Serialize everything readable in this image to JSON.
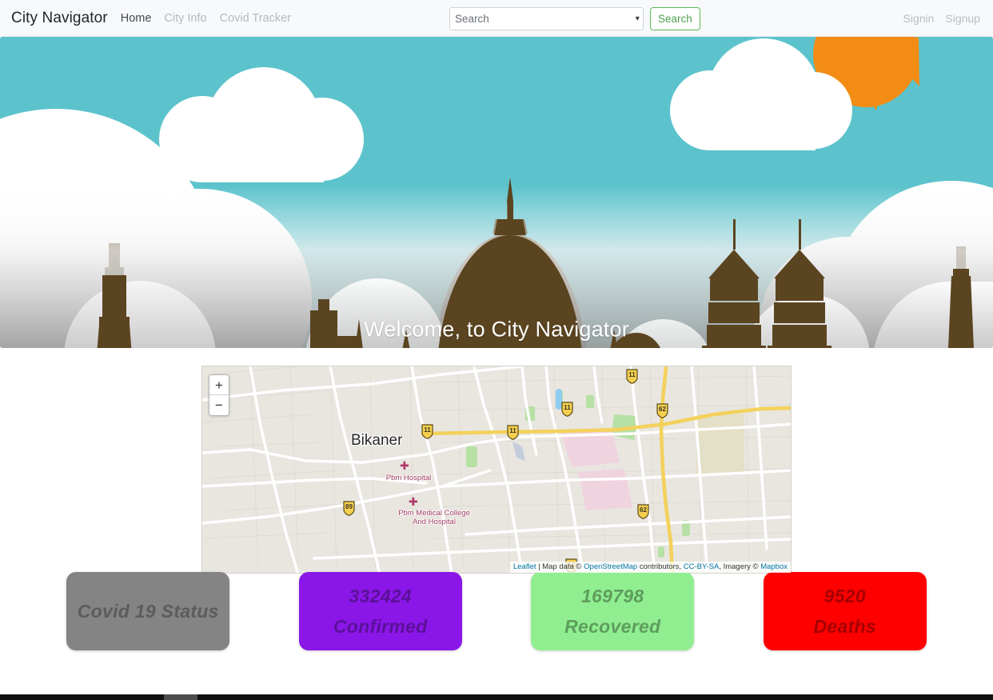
{
  "navbar": {
    "brand": "City Navigator",
    "links": [
      {
        "label": "Home",
        "active": true
      },
      {
        "label": "City Info",
        "active": false
      },
      {
        "label": "Covid Tracker",
        "active": false
      }
    ],
    "search": {
      "placeholder": "Search",
      "selected_value": "Search",
      "button_label": "Search",
      "button_color": "#5cb85c"
    },
    "auth": [
      {
        "label": "Signin"
      },
      {
        "label": "Signup"
      }
    ]
  },
  "hero": {
    "title": "Welcome, to City Navigator",
    "sky_color": "#5cc3cc",
    "sun_color": "#f28c14",
    "building_color": "#5b4420",
    "cloud_color": "#ffffff"
  },
  "map": {
    "city_label": "Bikaner",
    "pois": [
      {
        "name": "Pbm Hospital"
      },
      {
        "name": "Pbm Medical College",
        "name2": "And Hospital"
      }
    ],
    "highway_shields": [
      "11",
      "11",
      "62",
      "11",
      "89",
      "62",
      "62"
    ],
    "zoom_in_label": "+",
    "zoom_out_label": "−",
    "attribution": {
      "leaflet": "Leaflet",
      "sep1": " | Map data © ",
      "osm": "OpenStreetMap",
      "mid": " contributors, ",
      "license": "CC-BY-SA",
      "imagery": ", Imagery © ",
      "mapbox": "Mapbox"
    }
  },
  "covid": {
    "cards": [
      {
        "title": "Covid 19 Status",
        "number": "",
        "label": "",
        "bg": "#848484",
        "fg": "#5c5c5c"
      },
      {
        "title": "",
        "number": "332424",
        "label": "Confirmed",
        "bg": "#8a16e8",
        "fg": "#5b1099"
      },
      {
        "title": "",
        "number": "169798",
        "label": "Recovered",
        "bg": "#90ee90",
        "fg": "#5e9d5e"
      },
      {
        "title": "",
        "number": "9520",
        "label": "Deaths",
        "bg": "#fe0000",
        "fg": "#a60000"
      }
    ]
  }
}
